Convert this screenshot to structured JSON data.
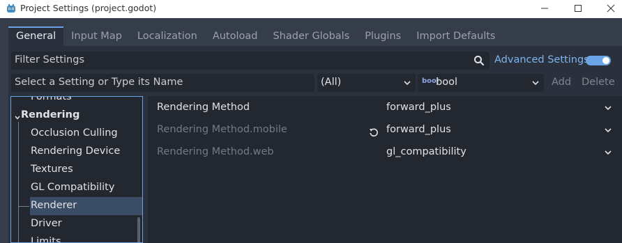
{
  "window": {
    "title": "Project Settings (project.godot)",
    "icon": "godot-icon",
    "controls": [
      "minimize-icon",
      "maximize-icon",
      "close-icon"
    ]
  },
  "tabs": [
    {
      "label": "General",
      "active": true
    },
    {
      "label": "Input Map",
      "active": false
    },
    {
      "label": "Localization",
      "active": false
    },
    {
      "label": "Autoload",
      "active": false
    },
    {
      "label": "Shader Globals",
      "active": false
    },
    {
      "label": "Plugins",
      "active": false
    },
    {
      "label": "Import Defaults",
      "active": false
    }
  ],
  "filter": {
    "placeholder": "Filter Settings",
    "icon": "search-icon",
    "advanced_label": "Advanced Settings",
    "advanced_enabled": true
  },
  "add_setting": {
    "name_placeholder": "Select a Setting or Type its Name",
    "scope_value": "(All)",
    "type_icon": "bool",
    "type_value": "bool",
    "add_label": "Add",
    "delete_label": "Delete"
  },
  "tree": {
    "items": [
      {
        "label": "Formats",
        "level": 1
      },
      {
        "label": "Rendering",
        "level": 0,
        "expanded": true
      },
      {
        "label": "Occlusion Culling",
        "level": 1
      },
      {
        "label": "Rendering Device",
        "level": 1
      },
      {
        "label": "Textures",
        "level": 1
      },
      {
        "label": "GL Compatibility",
        "level": 1
      },
      {
        "label": "Renderer",
        "level": 1,
        "selected": true
      },
      {
        "label": "Driver",
        "level": 1
      },
      {
        "label": "Limits",
        "level": 1
      }
    ]
  },
  "settings": [
    {
      "label": "Rendering Method",
      "value": "forward_plus",
      "enabled": true,
      "revertable": false
    },
    {
      "label": "Rendering Method.mobile",
      "value": "forward_plus",
      "enabled": false,
      "revertable": true
    },
    {
      "label": "Rendering Method.web",
      "value": "gl_compatibility",
      "enabled": false,
      "revertable": false
    }
  ],
  "colors": {
    "accent": "#6aa3e6",
    "background": "#363d4a",
    "panel": "#2b313c",
    "field": "#232830",
    "selection": "#3b4d66"
  }
}
